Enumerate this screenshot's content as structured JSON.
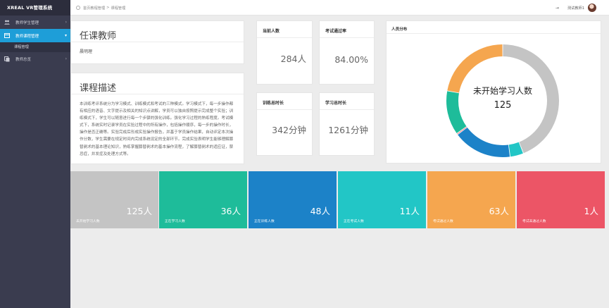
{
  "app": {
    "brand": "XREAL VR管理系统"
  },
  "sidebar": {
    "items": [
      {
        "label": "教师学生管理",
        "icon": "users-icon"
      },
      {
        "label": "教师课程管理",
        "icon": "book-icon",
        "active": true
      },
      {
        "label": "教师总览",
        "icon": "copy-icon"
      }
    ],
    "subitem": "课程管理"
  },
  "topbar": {
    "breadcrumb": [
      "首页教程管理",
      "课程管理"
    ],
    "separator": ">",
    "user": "测试教师1"
  },
  "teacher": {
    "title": "任课教师",
    "name": "晨明理"
  },
  "course": {
    "title": "课程描述",
    "description": "本训练考评系统分为学习模式、训练模式和考试的三种模式。学习模式下，每一步操作都有相应的语音、文字提示及相关的知识点讲解，学员可以独自按照提示完成整个实验；训练模式下，学生可以随意进行每一个步骤的强化训练。强化学习过程的熟练程度。考试模式下，系统实时记录学员在实验过程中的所有操作，包括操作顺序，每一步的操作时长，操作是否正确等。实验完成后形成实验操作报告，并基于学员操作结果，自动评定本次操作分数，学生需要在规定时间内完成系统设定的全部环节。完成实验表明学生能够理解膝替剥术的基本理论知识，熟练掌握膝替剥术的基本操作流程，了解膝替剥术的适应证，禁忌症，并发症及处理方式等。"
  },
  "stats": [
    {
      "title": "当前人数",
      "value": "284人"
    },
    {
      "title": "考试通过率",
      "value": "84.00%"
    },
    {
      "title": "训练总时长",
      "value": "342分钟"
    },
    {
      "title": "学习总时长",
      "value": "1261分钟"
    }
  ],
  "chart_data": {
    "type": "pie",
    "title": "人员分布",
    "center_label": "未开始学习人数",
    "center_value": "125",
    "series": [
      {
        "name": "未开始学习人数",
        "value": 125,
        "color": "#c4c4c4"
      },
      {
        "name": "正在学习人数",
        "value": 36,
        "color": "#1ebc9a"
      },
      {
        "name": "正在训练人数",
        "value": 48,
        "color": "#1c82c8"
      },
      {
        "name": "正在考试人数",
        "value": 11,
        "color": "#22c6c6"
      },
      {
        "name": "考试通过人数",
        "value": 63,
        "color": "#f5a64f"
      },
      {
        "name": "考试未通过人数",
        "value": 1,
        "color": "#ec5566"
      }
    ],
    "order_clockwise_from_top": [
      "未开始学习人数",
      "正在考试人数",
      "正在训练人数",
      "考试未通过人数",
      "正在学习人数",
      "考试通过人数"
    ]
  },
  "cards": [
    {
      "value": "125人",
      "label": "未开始学习人数",
      "color": "#c4c4c4"
    },
    {
      "value": "36人",
      "label": "正在学习人数",
      "color": "#1ebc9a"
    },
    {
      "value": "48人",
      "label": "正在训练人数",
      "color": "#1c82c8"
    },
    {
      "value": "11人",
      "label": "正在考试人数",
      "color": "#22c6c6"
    },
    {
      "value": "63人",
      "label": "考试通过人数",
      "color": "#f5a64f"
    },
    {
      "value": "1人",
      "label": "考试未通过人数",
      "color": "#ec5566"
    }
  ]
}
